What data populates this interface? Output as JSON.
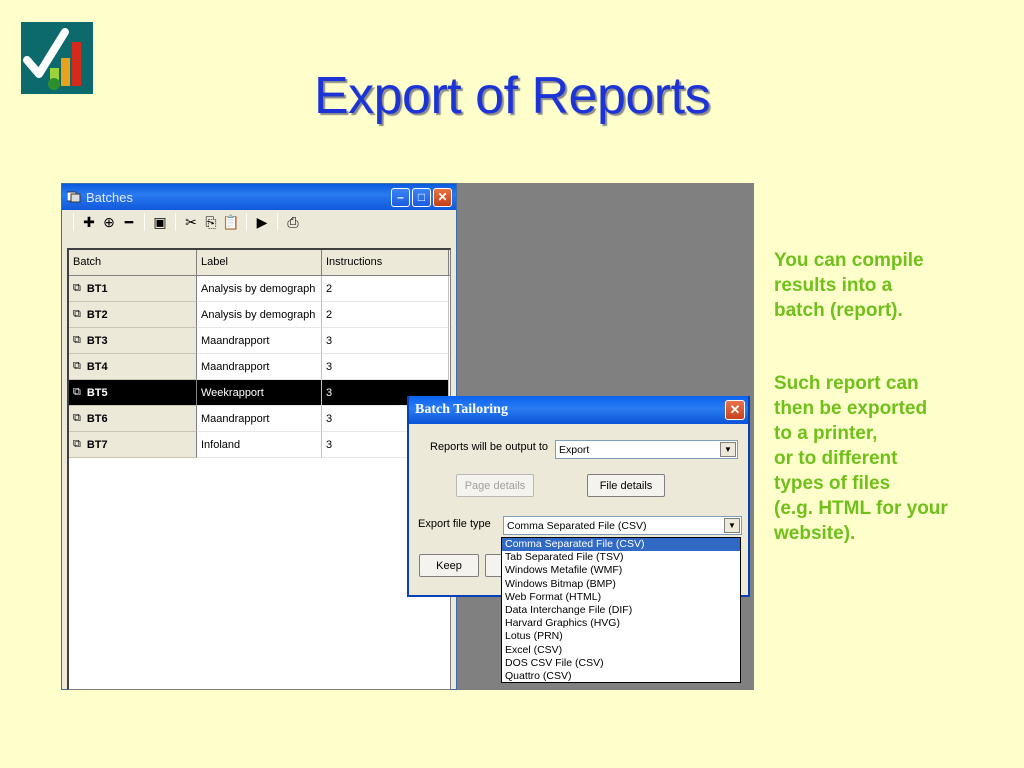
{
  "slide": {
    "title": "Export of Reports"
  },
  "side_text": {
    "para1": [
      "You can compile",
      "results into a",
      "batch (report)."
    ],
    "para2": [
      "Such report can",
      "then be exported",
      "to a printer,",
      "or to different",
      "types of files",
      "(e.g. HTML for your",
      "website)."
    ]
  },
  "batches_window": {
    "title": "Batches",
    "toolbar": [
      "add-icon",
      "add-linked-icon",
      "remove-icon",
      "properties-icon",
      "cut-icon",
      "copy-icon",
      "paste-icon",
      "run-icon",
      "print-icon"
    ],
    "columns": [
      "Batch",
      "Label",
      "Instructions"
    ],
    "rows": [
      {
        "batch": "BT1",
        "label": "Analysis by demograph",
        "instructions": "2"
      },
      {
        "batch": "BT2",
        "label": "Analysis by demograph",
        "instructions": "2"
      },
      {
        "batch": "BT3",
        "label": "Maandrapport",
        "instructions": "3"
      },
      {
        "batch": "BT4",
        "label": "Maandrapport",
        "instructions": "3"
      },
      {
        "batch": "BT5",
        "label": "Weekrapport",
        "instructions": "3"
      },
      {
        "batch": "BT6",
        "label": "Maandrapport",
        "instructions": "3"
      },
      {
        "batch": "BT7",
        "label": "Infoland",
        "instructions": "3"
      }
    ],
    "selected_row": "BT5"
  },
  "batch_tailoring": {
    "title": "Batch Tailoring",
    "output_label": "Reports will be output to",
    "output_value": "Export",
    "page_details_label": "Page details",
    "file_details_label": "File details",
    "export_type_label": "Export file type",
    "export_type_value": "Comma Separated File (CSV)",
    "keep_label": "Keep",
    "options": [
      "Comma Separated File (CSV)",
      "Tab Separated File (TSV)",
      "Windows Metafile (WMF)",
      "Windows Bitmap (BMP)",
      "Web Format (HTML)",
      "Data Interchange File (DIF)",
      "Harvard Graphics (HVG)",
      "Lotus (PRN)",
      "Excel (CSV)",
      "DOS CSV File (CSV)",
      "Quattro (CSV)"
    ],
    "highlighted_option": "Comma Separated File (CSV)"
  },
  "colors": {
    "background": "#ffffcc",
    "title": "#1c34d6",
    "side_text": "#70c01b",
    "selection": "#316ac5"
  }
}
